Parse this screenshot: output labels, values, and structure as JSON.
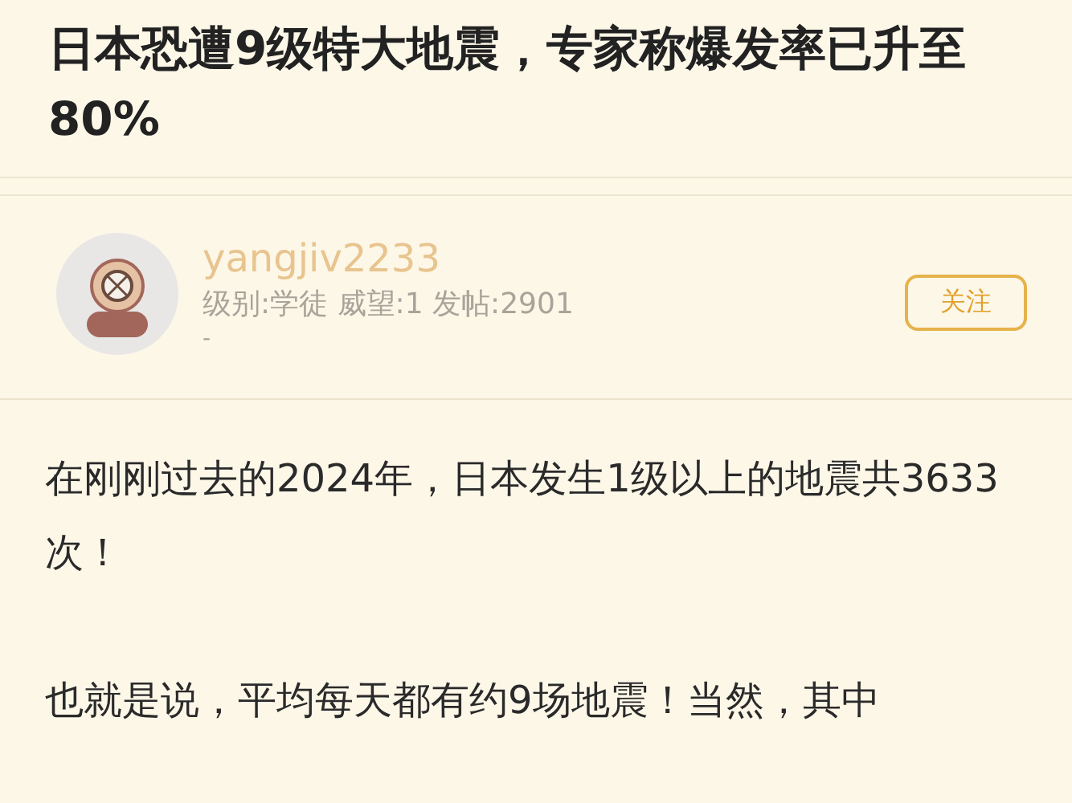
{
  "post": {
    "title": "日本恐遭9级特大地震，专家称爆发率已升至80%"
  },
  "author": {
    "name": "yangjiv2233",
    "meta": "级别:学徒 威望:1 发帖:2901",
    "signature": "-",
    "follow_button": "关注"
  },
  "body": {
    "paragraphs": [
      "在刚刚过去的2024年，日本发生1级以上的地震共3633次！",
      "也就是说，平均每天都有约9场地震！当然，其中"
    ]
  }
}
